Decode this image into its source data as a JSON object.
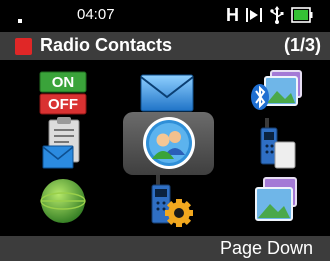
{
  "status": {
    "time": "04:07",
    "h_label": "H",
    "icons": [
      "signal-strength-icon",
      "scan-icon",
      "usb-icon",
      "battery-icon"
    ]
  },
  "title_bar": {
    "title": "Radio Contacts",
    "page_indicator": "(1/3)",
    "indicator_color": "#e02727"
  },
  "menu_icons": [
    {
      "name": "on-off-icon",
      "on_label": "ON",
      "off_label": "OFF"
    },
    {
      "name": "messages-icon"
    },
    {
      "name": "bluetooth-images-icon"
    },
    {
      "name": "clipboard-mail-icon"
    },
    {
      "name": "radio-contacts-icon",
      "selected": true
    },
    {
      "name": "radio-battery-icon"
    },
    {
      "name": "green-globe-icon"
    },
    {
      "name": "radio-settings-icon"
    },
    {
      "name": "gallery-icon"
    }
  ],
  "softkeys": {
    "right": "Page Down"
  },
  "colors": {
    "bar_bg": "#3c3c3c",
    "accent_red": "#e02727"
  }
}
